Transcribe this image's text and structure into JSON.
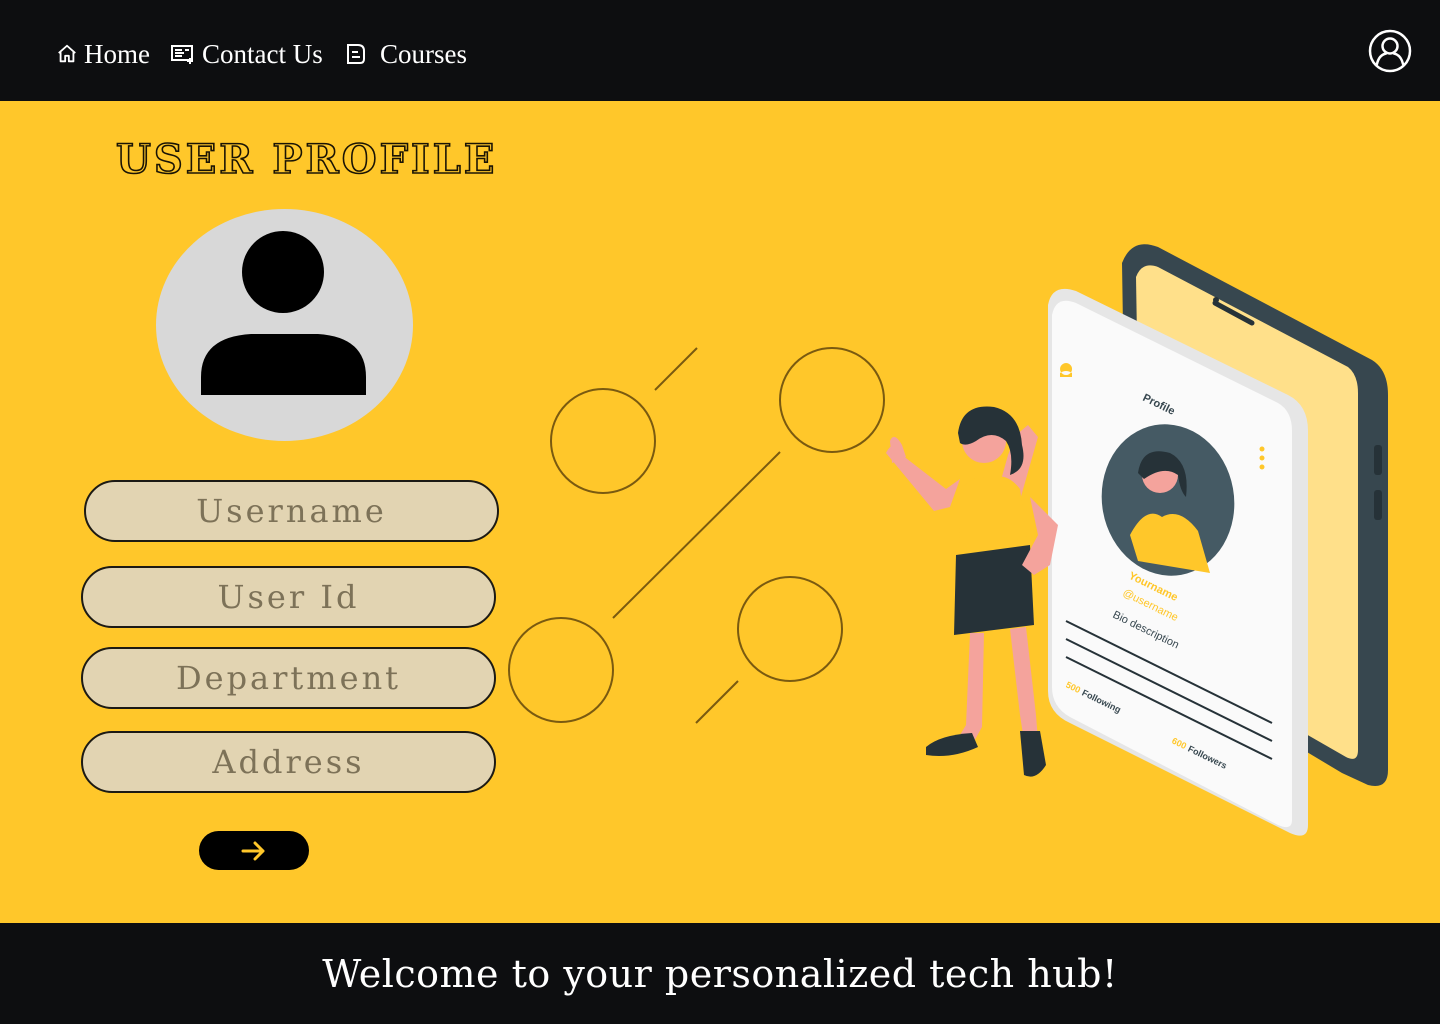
{
  "nav": {
    "items": [
      {
        "label": "Home",
        "icon": "home-icon"
      },
      {
        "label": "Contact Us",
        "icon": "contact-card-icon"
      },
      {
        "label": "Courses",
        "icon": "courses-icon"
      }
    ],
    "profile_icon": "user-circle-icon"
  },
  "profile": {
    "heading": "USER PROFILE",
    "avatar_icon": "user-avatar-icon",
    "fields": {
      "username": {
        "placeholder": "Username",
        "value": ""
      },
      "user_id": {
        "placeholder": "User Id",
        "value": ""
      },
      "department": {
        "placeholder": "Department",
        "value": ""
      },
      "address": {
        "placeholder": "Address",
        "value": ""
      }
    },
    "submit_icon": "arrow-right-icon"
  },
  "illustration": {
    "card_title": "Profile",
    "name": "Yourname",
    "handle": "@username",
    "bio": "Bio description",
    "following_count": "500",
    "following_label": "Following",
    "followers_count": "600",
    "followers_label": "Followers"
  },
  "footer": {
    "text": "Welcome to your personalized tech hub!"
  },
  "colors": {
    "background": "#ffc72a",
    "bar": "#0d0e10",
    "field_fill": "#e2d4b2",
    "accent": "#ffc72a"
  }
}
